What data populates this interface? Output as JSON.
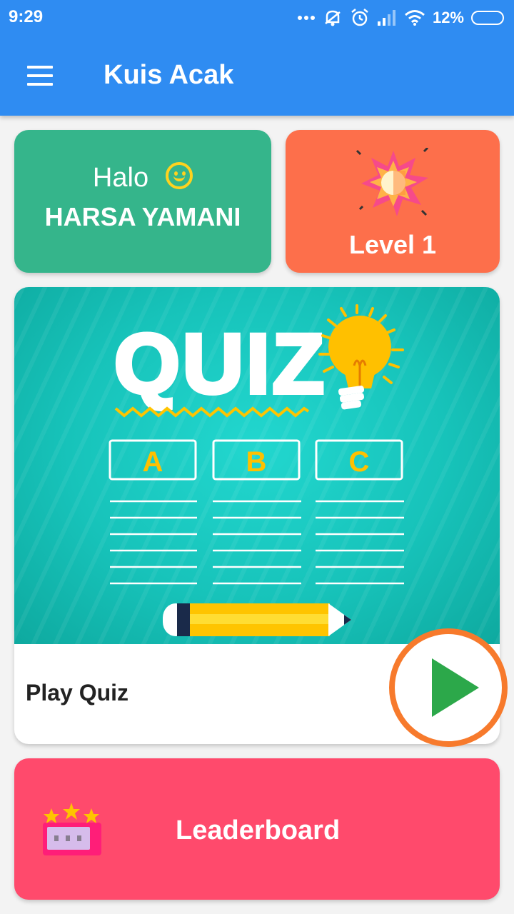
{
  "status_bar": {
    "time": "9:29",
    "battery": "12%",
    "icons": [
      "dots-icon",
      "mute-icon",
      "alarm-icon",
      "signal-icon",
      "wifi-icon",
      "battery-icon"
    ]
  },
  "app_bar": {
    "title": "Kuis Acak",
    "menu_icon": "hamburger-menu-icon",
    "color": "#2f8cf2"
  },
  "greeting": {
    "halo": "Halo",
    "name": "HARSA YAMANI",
    "icon": "smiley-icon",
    "color": "#35b58b"
  },
  "level": {
    "label": "Level 1",
    "icon": "burst-star-icon",
    "color": "#fd6f4b"
  },
  "quiz": {
    "banner_title": "QUIZ",
    "options": [
      "A",
      "B",
      "C"
    ],
    "play_label": "Play Quiz",
    "play_icon": "play-icon",
    "play_ring_color": "#f77a2c",
    "play_color": "#2ca84a"
  },
  "leaderboard": {
    "label": "Leaderboard",
    "icon": "trophy-stars-icon",
    "color": "#ff4a6c"
  }
}
